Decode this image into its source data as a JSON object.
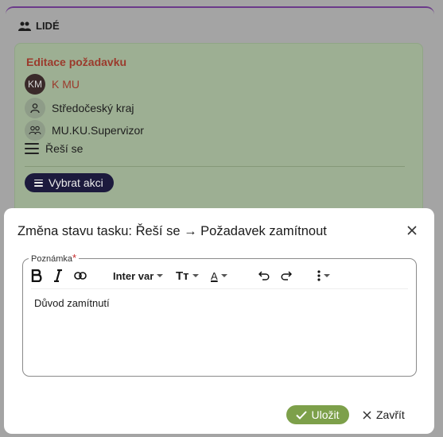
{
  "section": {
    "title": "LIDÉ",
    "icon": "people-icon"
  },
  "task": {
    "title": "Editace požadavku",
    "assignee": {
      "initials": "KM",
      "name": "K MU"
    },
    "region": "Středočeský kraj",
    "role": "MU.KU.Supervizor",
    "status": "Řeší se",
    "action_label": "Vybrat akci"
  },
  "modal": {
    "title": "Změna stavu tasku: Řeší se → Požadavek zamítnout",
    "field_label": "Poznámka",
    "required_mark": "*",
    "toolbar": {
      "font_family": "Inter var",
      "font_size_icon": "Tт",
      "text_color_icon": "A"
    },
    "note_value": "Důvod zamítnutí",
    "save_label": "Uložit",
    "cancel_label": "Zavřít"
  },
  "colors": {
    "accent_dark": "#1c1a3d",
    "task_title": "#9b3a2c",
    "save_green": "#7da04a",
    "required_red": "#c62828"
  }
}
